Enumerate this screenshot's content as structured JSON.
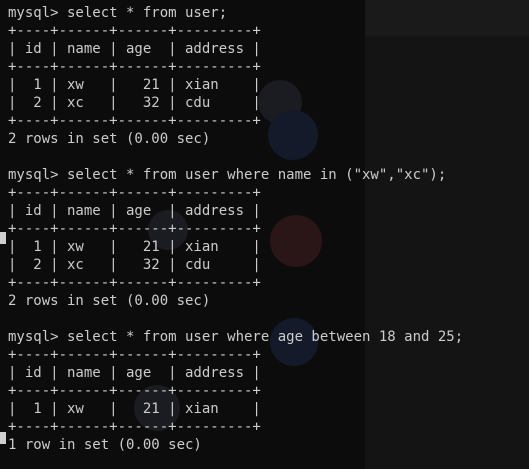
{
  "terminal": {
    "lines": [
      "mysql> select * from user;",
      "+----+------+------+---------+",
      "| id | name | age  | address |",
      "+----+------+------+---------+",
      "|  1 | xw   |   21 | xian    |",
      "|  2 | xc   |   32 | cdu     |",
      "+----+------+------+---------+",
      "2 rows in set (0.00 sec)",
      "",
      "mysql> select * from user where name in (\"xw\",\"xc\");",
      "+----+------+------+---------+",
      "| id | name | age  | address |",
      "+----+------+------+---------+",
      "|  1 | xw   |   21 | xian    |",
      "|  2 | xc   |   32 | cdu     |",
      "+----+------+------+---------+",
      "2 rows in set (0.00 sec)",
      "",
      "mysql> select * from user where age between 18 and 25;",
      "+----+------+------+---------+",
      "| id | name | age  | address |",
      "+----+------+------+---------+",
      "|  1 | xw   |   21 | xian    |",
      "+----+------+------+---------+",
      "1 row in set (0.00 sec)"
    ]
  },
  "colors": {
    "background": "#0c0c0c",
    "text": "#cccccc"
  }
}
